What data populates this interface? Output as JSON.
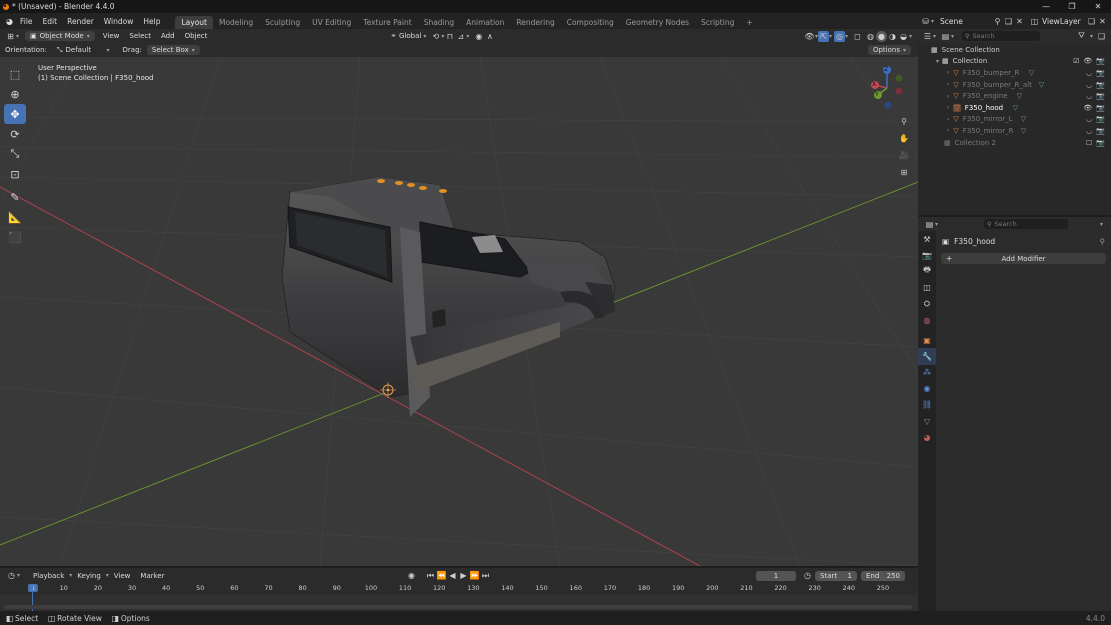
{
  "window": {
    "title": "* (Unsaved) - Blender 4.4.0",
    "controls": [
      "—",
      "❐",
      "✕"
    ]
  },
  "menu": [
    "File",
    "Edit",
    "Render",
    "Window",
    "Help"
  ],
  "workspaces": [
    "Layout",
    "Modeling",
    "Sculpting",
    "UV Editing",
    "Texture Paint",
    "Shading",
    "Animation",
    "Rendering",
    "Compositing",
    "Geometry Nodes",
    "Scripting"
  ],
  "workspace_add": "+",
  "scene": {
    "label": "Scene",
    "view_layer": "ViewLayer"
  },
  "viewport_header": {
    "mode": "Object Mode",
    "menus": [
      "View",
      "Select",
      "Add",
      "Object"
    ],
    "transform": "Global",
    "orientation_label": "Orientation:",
    "orientation_value": "Default",
    "drag_label": "Drag:",
    "drag_value": "Select Box",
    "options": "Options"
  },
  "viewport": {
    "perspective": "User Perspective",
    "collection_info": "(1) Scene Collection | F350_hood"
  },
  "gizmo": {
    "x": "X",
    "y": "Y",
    "z": "Z"
  },
  "outliner": {
    "search_placeholder": "Search",
    "root": "Scene Collection",
    "collection": "Collection",
    "items": [
      {
        "name": "F350_bumper_R",
        "dim": true
      },
      {
        "name": "F350_bumper_R_alt",
        "dim": true
      },
      {
        "name": "F350_engine",
        "dim": true
      },
      {
        "name": "F350_hood",
        "dim": false
      },
      {
        "name": "F350_mirror_L",
        "dim": true
      },
      {
        "name": "F350_mirror_R",
        "dim": true
      }
    ],
    "collection2": "Collection 2"
  },
  "properties": {
    "search_placeholder": "Search",
    "object_name": "F350_hood",
    "add_modifier": "Add Modifier"
  },
  "timeline": {
    "menus": [
      "Playback",
      "Keying",
      "View",
      "Marker"
    ],
    "current_frame": "1",
    "start_label": "Start",
    "start_value": "1",
    "end_label": "End",
    "end_value": "250",
    "ticks": [
      "1",
      "10",
      "20",
      "30",
      "40",
      "50",
      "60",
      "70",
      "80",
      "90",
      "100",
      "110",
      "120",
      "130",
      "140",
      "150",
      "160",
      "170",
      "180",
      "190",
      "200",
      "210",
      "220",
      "230",
      "240",
      "250"
    ]
  },
  "statusbar": {
    "items": [
      "Select",
      "Rotate View",
      "Options"
    ],
    "version": "4.4.0"
  },
  "colors": {
    "accent": "#4772b3",
    "x_axis": "#b8434f",
    "y_axis": "#6c9a2b",
    "orange": "#e87d0d"
  }
}
